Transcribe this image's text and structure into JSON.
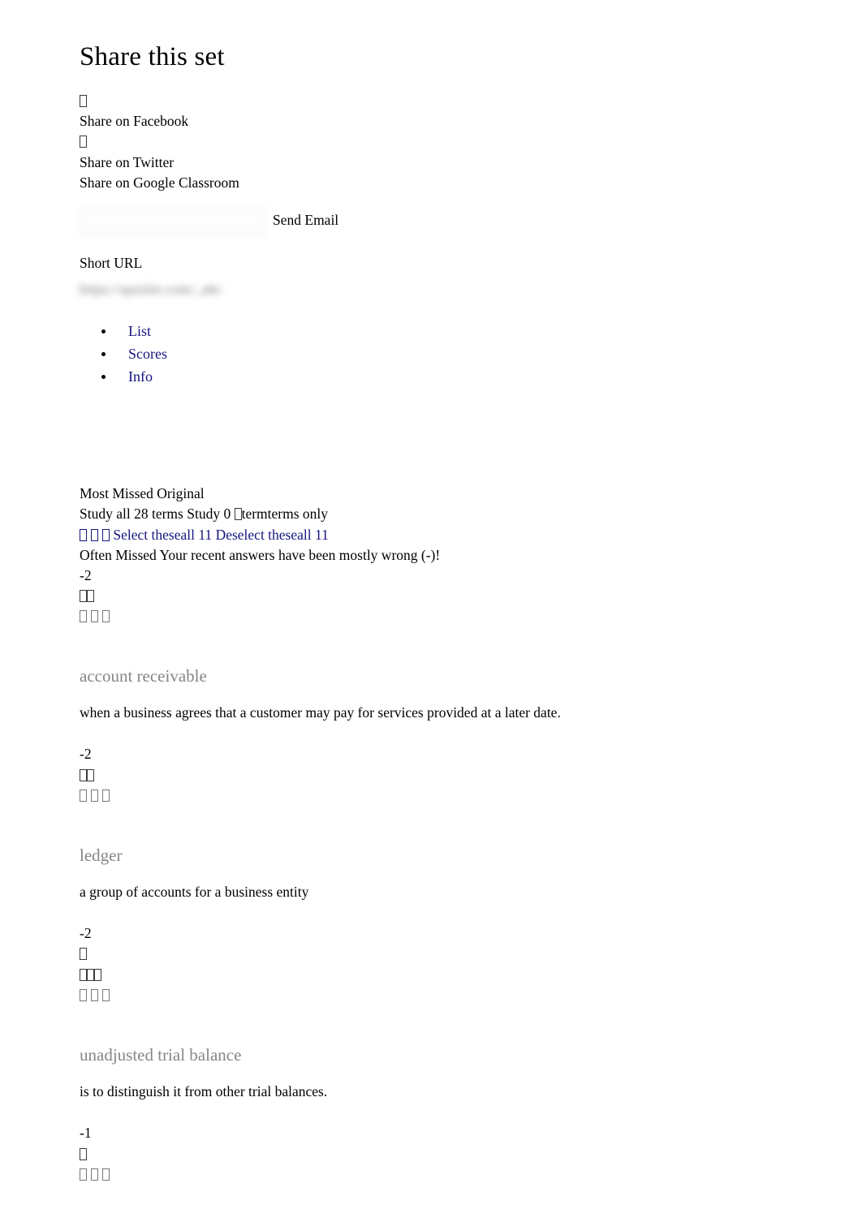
{
  "page": {
    "title": "Share this set"
  },
  "share": {
    "facebook_icon": "facebook-icon-missing-glyph",
    "facebook_label": "Share on Facebook",
    "twitter_icon": "twitter-icon-missing-glyph",
    "twitter_label": "Share on Twitter",
    "classroom_label": "Share on Google Classroom",
    "email_input_value": "",
    "email_input_placeholder": "",
    "send_email_label": "Send Email",
    "short_url_label": "Short URL",
    "short_url_value": "https://quizlet.com/_abc"
  },
  "nav": {
    "items": [
      {
        "label": "List"
      },
      {
        "label": "Scores"
      },
      {
        "label": "Info"
      }
    ]
  },
  "set_info": {
    "mode_label": "Most Missed Original",
    "study_line": "Study all 28 terms Study 0 ▯ termterms only",
    "study_all_label": "Study all 28 terms",
    "study_some_label": "Study 0",
    "study_terms_suffix": "termterms only",
    "select_all_label": "Select theseall 11",
    "deselect_all_label": "Deselect theseall 11",
    "often_missed_label": "Often Missed",
    "often_missed_text": "Your recent answers have been mostly wrong (-)!",
    "score": "-2"
  },
  "terms": [
    {
      "term": "account receivable",
      "definition": "when a business agrees that a customer may pay for services provided at a later date.",
      "score": "-2",
      "meta_rows": [
        {
          "boxes": 2,
          "spaced": false
        },
        {
          "boxes": 3,
          "spaced": true
        }
      ]
    },
    {
      "term": "ledger",
      "definition": "a group of accounts for a business entity",
      "score": "-2",
      "meta_rows": [
        {
          "boxes": 1,
          "spaced": false
        },
        {
          "boxes": 3,
          "spaced": false
        },
        {
          "boxes": 3,
          "spaced": true
        }
      ]
    },
    {
      "term": "unadjusted trial balance",
      "definition": "is to distinguish it from other trial balances.",
      "score": "-1",
      "meta_rows": [
        {
          "boxes": 1,
          "spaced": false
        },
        {
          "boxes": 3,
          "spaced": true
        }
      ]
    }
  ],
  "colors": {
    "link": "#151580",
    "term_heading": "#868686",
    "body_text": "#000000",
    "background": "#ffffff"
  }
}
